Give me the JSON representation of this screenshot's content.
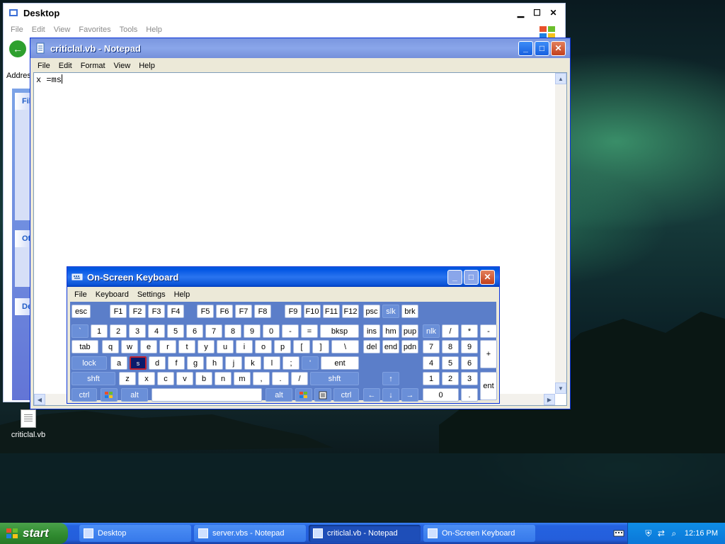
{
  "explorer": {
    "title": "Desktop",
    "menu": [
      "File",
      "Edit",
      "View",
      "Favorites",
      "Tools",
      "Help"
    ],
    "address_label": "Addres",
    "side_heads": [
      "Fil",
      "Ot",
      "De"
    ]
  },
  "notepad": {
    "title": "criticlal.vb - Notepad",
    "menu": [
      "File",
      "Edit",
      "Format",
      "View",
      "Help"
    ],
    "content": "x =ms"
  },
  "osk": {
    "title": "On-Screen Keyboard",
    "menu": [
      "File",
      "Keyboard",
      "Settings",
      "Help"
    ],
    "pressed_key": "s"
  },
  "desktop_icon": {
    "label": "criticlal.vb"
  },
  "taskbar": {
    "start_label": "start",
    "buttons": [
      {
        "label": "Desktop"
      },
      {
        "label": "server.vbs - Notepad"
      },
      {
        "label": "criticlal.vb - Notepad"
      },
      {
        "label": "On-Screen Keyboard"
      }
    ],
    "clock": "12:16 PM"
  },
  "colors": {
    "title_blue": "#0054e3",
    "osk_body": "#5b7ec9",
    "taskbar": "#245edb",
    "start_green": "#2f8a2f"
  }
}
